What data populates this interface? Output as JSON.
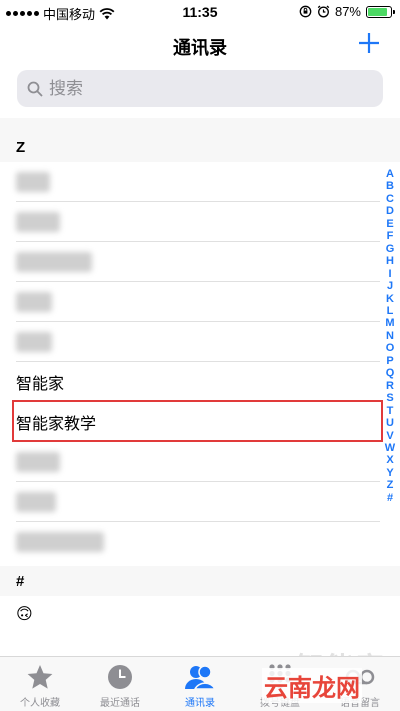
{
  "status_bar": {
    "carrier": "中国移动",
    "time": "11:35",
    "battery": "87%",
    "battery_level": 0.87
  },
  "nav": {
    "title": "通讯录",
    "add_icon": "plus-icon"
  },
  "search": {
    "placeholder": "搜索"
  },
  "sections": {
    "z_header": "Z",
    "hash_header": "#"
  },
  "contacts": {
    "named_1": "智能家",
    "named_2": "智能家教学",
    "emoji": "🙃"
  },
  "index_letters": [
    "A",
    "B",
    "C",
    "D",
    "E",
    "F",
    "G",
    "H",
    "I",
    "J",
    "K",
    "L",
    "M",
    "N",
    "O",
    "P",
    "Q",
    "R",
    "S",
    "T",
    "U",
    "V",
    "W",
    "X",
    "Y",
    "Z",
    "#"
  ],
  "tab_bar": {
    "favorites": "个人收藏",
    "recents": "最近通话",
    "contacts": "通讯录",
    "keypad": "拨号键盘",
    "voicemail": "语音留言"
  },
  "colors": {
    "accent": "#1e77f7",
    "highlight": "#e13a3a",
    "battery": "#4cd964"
  },
  "watermark": {
    "faint": "智能家",
    "brand": "云南龙网"
  }
}
